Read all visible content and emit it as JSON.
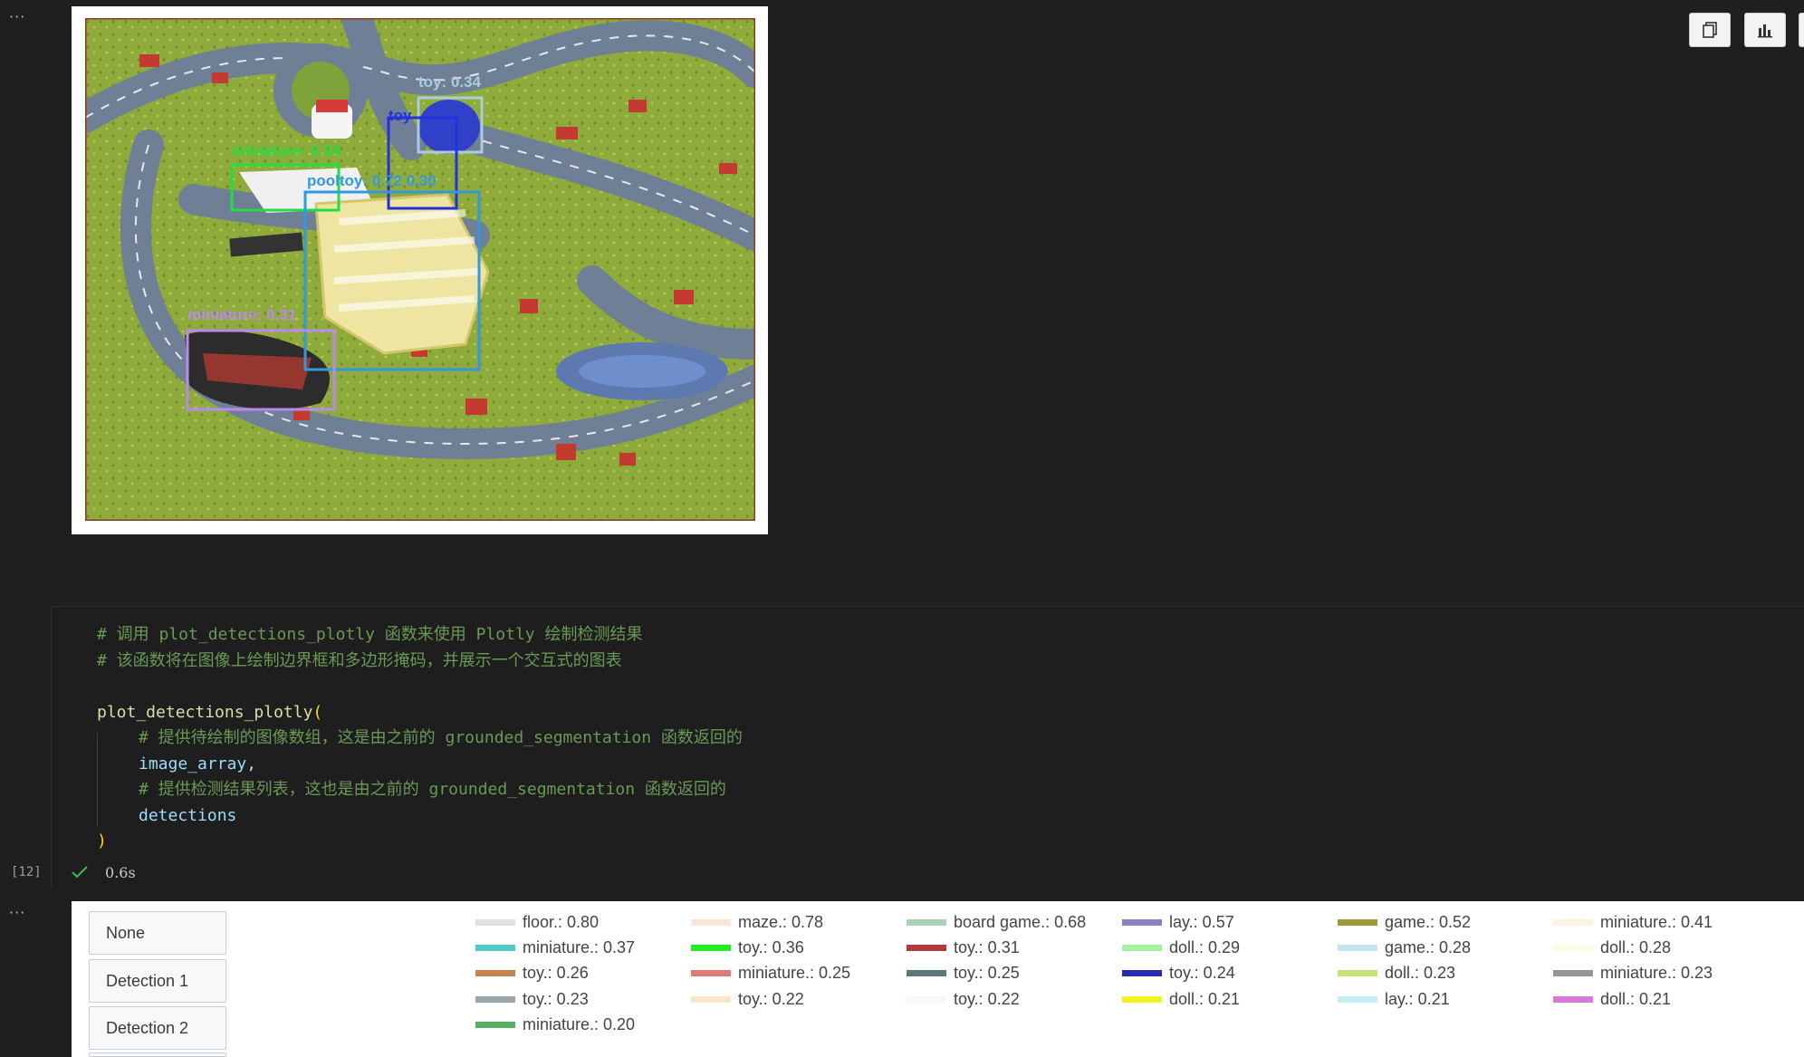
{
  "cells": {
    "output_top_more": "···",
    "output_bottom_more": "···"
  },
  "toolbar": {
    "copy_icon": "copy-icon",
    "chart_icon": "chart-icon"
  },
  "image_output": {
    "detection_labels": [
      {
        "text": "miniature: 0.34",
        "color": "#22dd44"
      },
      {
        "text": "toy: 0.34",
        "color": "#aaccdd"
      },
      {
        "text": "toy",
        "color": "#2233dd"
      },
      {
        "text": "miniature: 0.31",
        "color": "#bb88ee"
      },
      {
        "text": "pooltoy: 0.72 0.30",
        "color": "#3399dd"
      }
    ]
  },
  "code": {
    "line1": "# 调用 plot_detections_plotly 函数来使用 Plotly 绘制检测结果",
    "line2": "# 该函数将在图像上绘制边界框和多边形掩码，并展示一个交互式的图表",
    "line4_func": "plot_detections_plotly",
    "line4_paren": "(",
    "line5": "# 提供待绘制的图像数组，这是由之前的 grounded_segmentation 函数返回的",
    "line6_var": "image_array",
    "line6_punct": ",",
    "line7": "# 提供检测结果列表，这也是由之前的 grounded_segmentation 函数返回的",
    "line8_var": "detections",
    "line9_paren": ")"
  },
  "execution": {
    "count": "[12]",
    "time": "0.6s"
  },
  "plot": {
    "buttons": [
      "None",
      "Detection 1",
      "Detection 2"
    ],
    "legend": [
      {
        "label": "floor.: 0.80",
        "color": "#e0e0e0"
      },
      {
        "label": "maze.: 0.78",
        "color": "#fbe4d8"
      },
      {
        "label": "board game.: 0.68",
        "color": "#a9d3b4"
      },
      {
        "label": "lay.: 0.57",
        "color": "#8d7fc4"
      },
      {
        "label": "game.: 0.52",
        "color": "#9e9a3a"
      },
      {
        "label": "miniature.: 0.41",
        "color": "#fdf3e3"
      },
      {
        "label": "miniature.: 0.37",
        "color": "#4fcac6"
      },
      {
        "label": "toy.: 0.36",
        "color": "#22ee22"
      },
      {
        "label": "toy.: 0.31",
        "color": "#b23a3a"
      },
      {
        "label": "doll.: 0.29",
        "color": "#a7efa0"
      },
      {
        "label": "game.: 0.28",
        "color": "#c5e4ef"
      },
      {
        "label": "doll.: 0.28",
        "color": "#fbfbe6"
      },
      {
        "label": "toy.: 0.26",
        "color": "#c6834e"
      },
      {
        "label": "miniature.: 0.25",
        "color": "#e07a7a"
      },
      {
        "label": "toy.: 0.25",
        "color": "#5f7777"
      },
      {
        "label": "toy.: 0.24",
        "color": "#2a2ab0"
      },
      {
        "label": "doll.: 0.23",
        "color": "#c8e27a"
      },
      {
        "label": "miniature.: 0.23",
        "color": "#959595"
      },
      {
        "label": "toy.: 0.23",
        "color": "#9aa6ae"
      },
      {
        "label": "toy.: 0.22",
        "color": "#fde5cc"
      },
      {
        "label": "toy.: 0.22",
        "color": "#f3fbf5"
      },
      {
        "label": "doll.: 0.21",
        "color": "#f3f322"
      },
      {
        "label": "lay.: 0.21",
        "color": "#c6eff3"
      },
      {
        "label": "doll.: 0.21",
        "color": "#d77ad7"
      },
      {
        "label": "miniature.: 0.20",
        "color": "#55b060"
      }
    ]
  }
}
